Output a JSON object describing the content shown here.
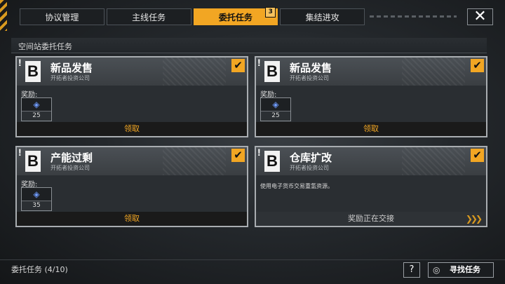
{
  "tabs": [
    {
      "label": "协议管理",
      "active": false
    },
    {
      "label": "主线任务",
      "active": false
    },
    {
      "label": "委托任务",
      "active": true,
      "badge": "3"
    },
    {
      "label": "集结进攻",
      "active": false
    }
  ],
  "close_symbol": "✕",
  "section_title": "空间站委托任务",
  "cards": [
    {
      "grade": "B",
      "title": "新品发售",
      "subtitle": "开拓者投资公司",
      "reward_label": "奖励:",
      "reward_count": "25",
      "action": "领取",
      "checked": true
    },
    {
      "grade": "B",
      "title": "新品发售",
      "subtitle": "开拓者投资公司",
      "reward_label": "奖励:",
      "reward_count": "25",
      "action": "领取",
      "checked": true
    },
    {
      "grade": "B",
      "title": "产能过剩",
      "subtitle": "开拓者投资公司",
      "reward_label": "奖励:",
      "reward_count": "35",
      "action": "领取",
      "checked": true
    },
    {
      "grade": "B",
      "title": "仓库扩改",
      "subtitle": "开拓者投资公司",
      "description": "使用电子货币交易重氢资源。",
      "status": "奖励正在交接",
      "checked": true
    }
  ],
  "footer": {
    "progress_label": "委托任务 (4/10)",
    "help_symbol": "?",
    "find_label": "寻找任务"
  },
  "colors": {
    "accent": "#f2a623",
    "reward_icon": "#6f9bff"
  },
  "icons": {
    "close": "close-icon",
    "check": "checkmark-icon",
    "reward": "crystal-icon",
    "find": "radar-icon"
  }
}
